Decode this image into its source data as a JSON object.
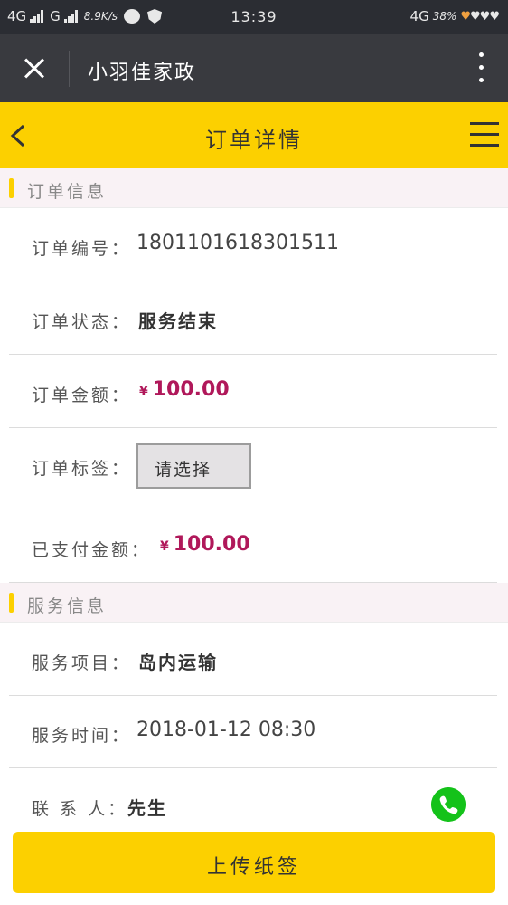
{
  "status_bar": {
    "network1": "4G",
    "network2": "G",
    "speed": "8.9K/s",
    "time": "13:39",
    "network3": "4G",
    "battery": "38%"
  },
  "wechat_bar": {
    "title": "小羽佳家政"
  },
  "header": {
    "title": "订单详情"
  },
  "order_section": {
    "title": "订单信息",
    "order_no_label": "订单编号：",
    "order_no": "1801101618301511",
    "status_label": "订单状态：",
    "status": "服务结束",
    "amount_label": "订单金额：",
    "amount_currency": "¥",
    "amount": "100.00",
    "tag_label": "订单标签：",
    "tag_select": "请选择",
    "paid_label": "已支付金额：",
    "paid_currency": "¥",
    "paid": "100.00"
  },
  "service_section": {
    "title": "服务信息",
    "item_label": "服务项目：",
    "item": "岛内运输",
    "time_label": "服务时间：",
    "time": "2018-01-12 08:30",
    "contact_label": "联 系 人：",
    "contact": "先生"
  },
  "bottom": {
    "upload_button": "上传纸签"
  },
  "colors": {
    "accent": "#fcd000",
    "price": "#b0185a",
    "phone": "#14c21a"
  }
}
